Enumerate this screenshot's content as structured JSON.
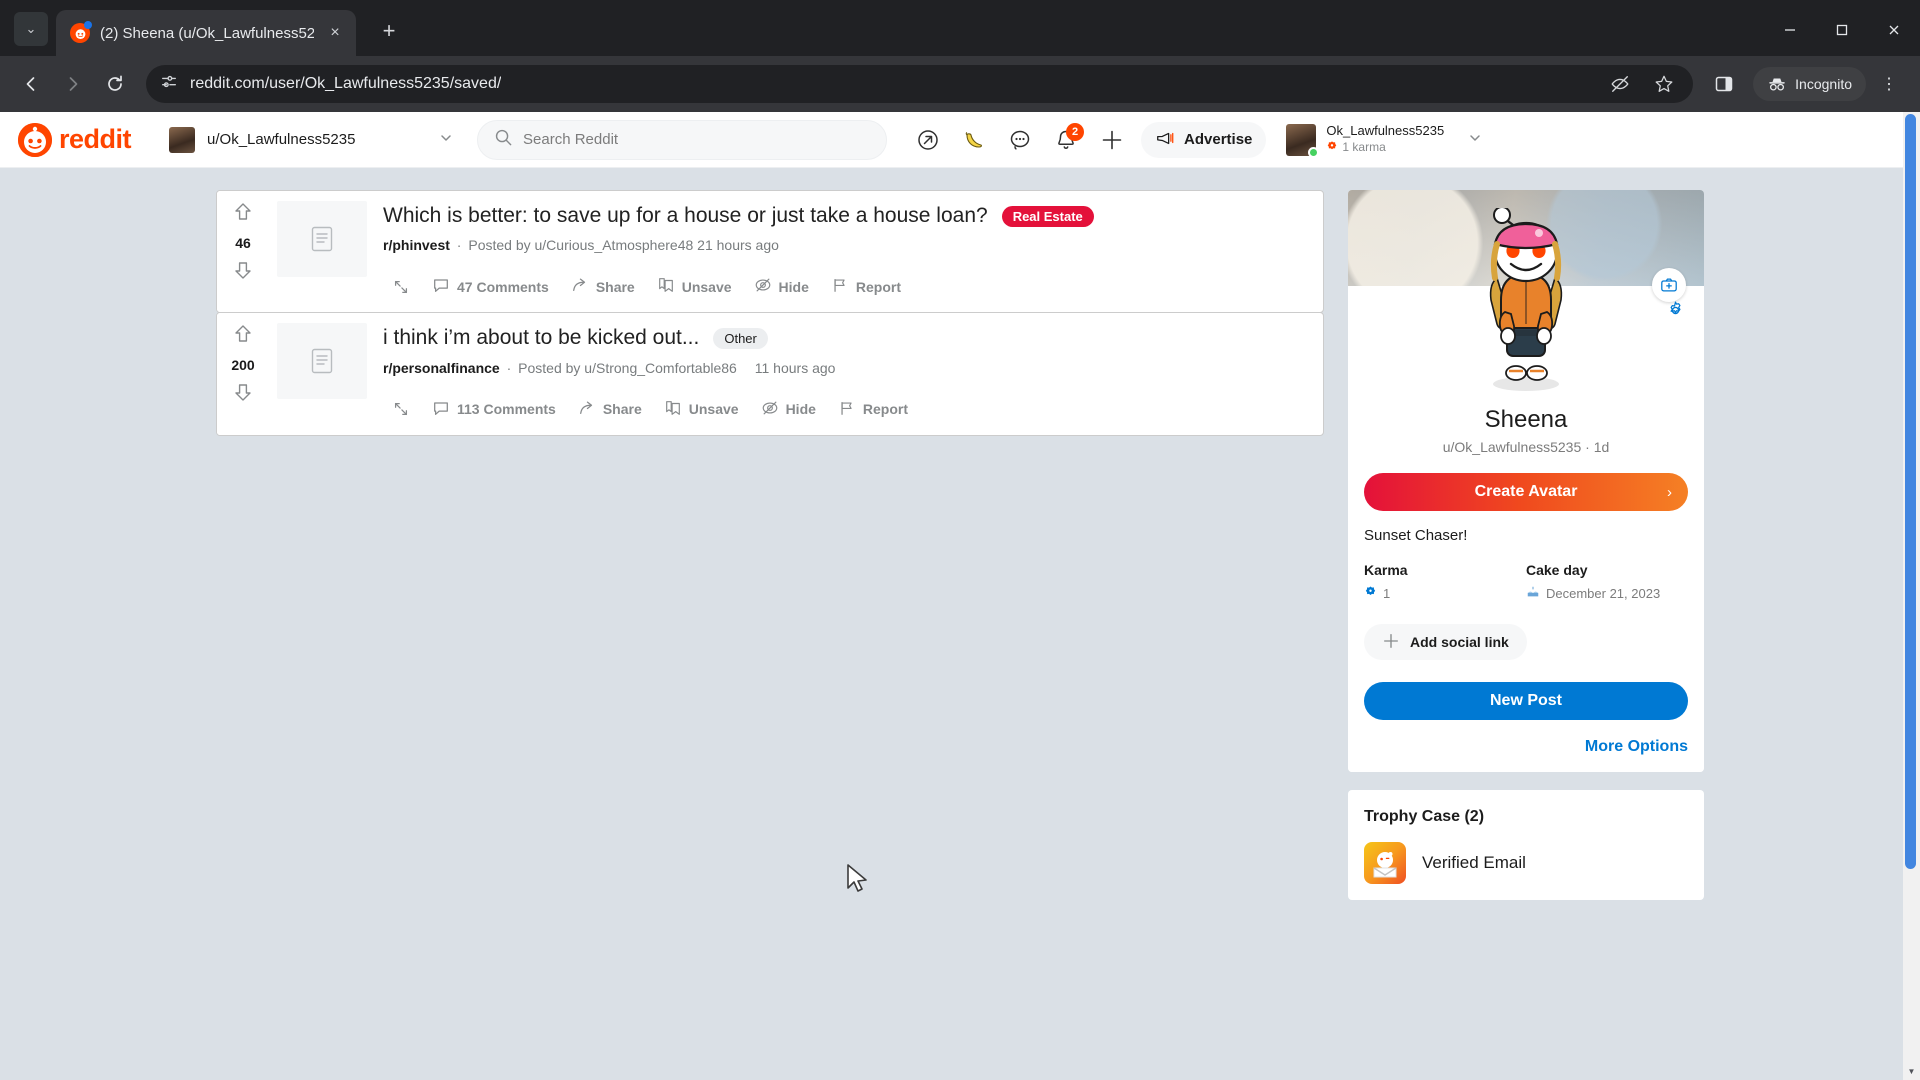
{
  "browser": {
    "tab": {
      "title": "(2) Sheena (u/Ok_Lawfulness52",
      "favicon": "reddit-favicon",
      "close_label": "×"
    },
    "new_tab_label": "+",
    "tabstrip_chevron": "⌄",
    "window_controls": {
      "minimize": "—",
      "maximize": "❐",
      "close": "✕"
    },
    "nav": {
      "back": "←",
      "forward": "→",
      "reload": "↻"
    },
    "omnibox": {
      "url": "reddit.com/user/Ok_Lawfulness5235/saved/",
      "site_info_icon": "page-settings-icon"
    },
    "actions": {
      "eye_off": "hide-tracking-icon",
      "bookmark": "star-icon",
      "side_panel": "side-panel-icon"
    },
    "incognito_label": "Incognito",
    "menu_label": "⋮"
  },
  "header": {
    "logo_text": "reddit",
    "user_switcher": {
      "label": "u/Ok_Lawfulness5235",
      "chevron": "⌄"
    },
    "search": {
      "placeholder": "Search Reddit",
      "icon": "search-icon"
    },
    "icons": [
      {
        "name": "popular-icon"
      },
      {
        "name": "banana-icon"
      },
      {
        "name": "chat-icon"
      },
      {
        "name": "notifications-icon",
        "badge": "2"
      },
      {
        "name": "create-post-icon"
      }
    ],
    "advertise_label": "Advertise",
    "user_menu": {
      "username": "Ok_Lawfulness5235",
      "karma": "1 karma",
      "chevron": "⌄",
      "online": true
    }
  },
  "feed": {
    "posts": [
      {
        "score": "46",
        "title": "Which is better: to save up for a house or just take a house loan?",
        "flair": "Real Estate",
        "flair_style": "red",
        "subreddit": "r/phinvest",
        "posted_by": "Posted by u/Curious_Atmosphere48",
        "timestamp": "21 hours ago",
        "actions": [
          {
            "label": "47 Comments",
            "icon": "comment-icon"
          },
          {
            "label": "Share",
            "icon": "share-icon"
          },
          {
            "label": "Unsave",
            "icon": "bookmark-icon"
          },
          {
            "label": "Hide",
            "icon": "hide-icon"
          },
          {
            "label": "Report",
            "icon": "flag-icon"
          }
        ]
      },
      {
        "score": "200",
        "title": "i think i’m about to be kicked out...",
        "flair": "Other",
        "flair_style": "grey",
        "subreddit": "r/personalfinance",
        "posted_by": "Posted by u/Strong_Comfortable86",
        "timestamp": "11 hours ago",
        "actions": [
          {
            "label": "113 Comments",
            "icon": "comment-icon"
          },
          {
            "label": "Share",
            "icon": "share-icon"
          },
          {
            "label": "Unsave",
            "icon": "bookmark-icon"
          },
          {
            "label": "Hide",
            "icon": "hide-icon"
          },
          {
            "label": "Report",
            "icon": "flag-icon"
          }
        ]
      }
    ]
  },
  "sidebar": {
    "profile": {
      "display_name": "Sheena",
      "handle": "u/Ok_Lawfulness5235 · 1d",
      "create_avatar_label": "Create Avatar",
      "create_avatar_chevron": "›",
      "bio": "Sunset Chaser!",
      "karma_label": "Karma",
      "karma_value": "1",
      "cakeday_label": "Cake day",
      "cakeday_value": "December 21, 2023",
      "add_social_label": "Add social link",
      "new_post_label": "New Post",
      "more_options_label": "More Options"
    },
    "trophy_case": {
      "title": "Trophy Case (2)",
      "items": [
        {
          "name": "Verified Email"
        }
      ]
    }
  },
  "colors": {
    "reddit_orange": "#ff4500",
    "link_blue": "#0079d3",
    "flair_red": "#e4113a",
    "page_bg": "#dae0e6"
  }
}
